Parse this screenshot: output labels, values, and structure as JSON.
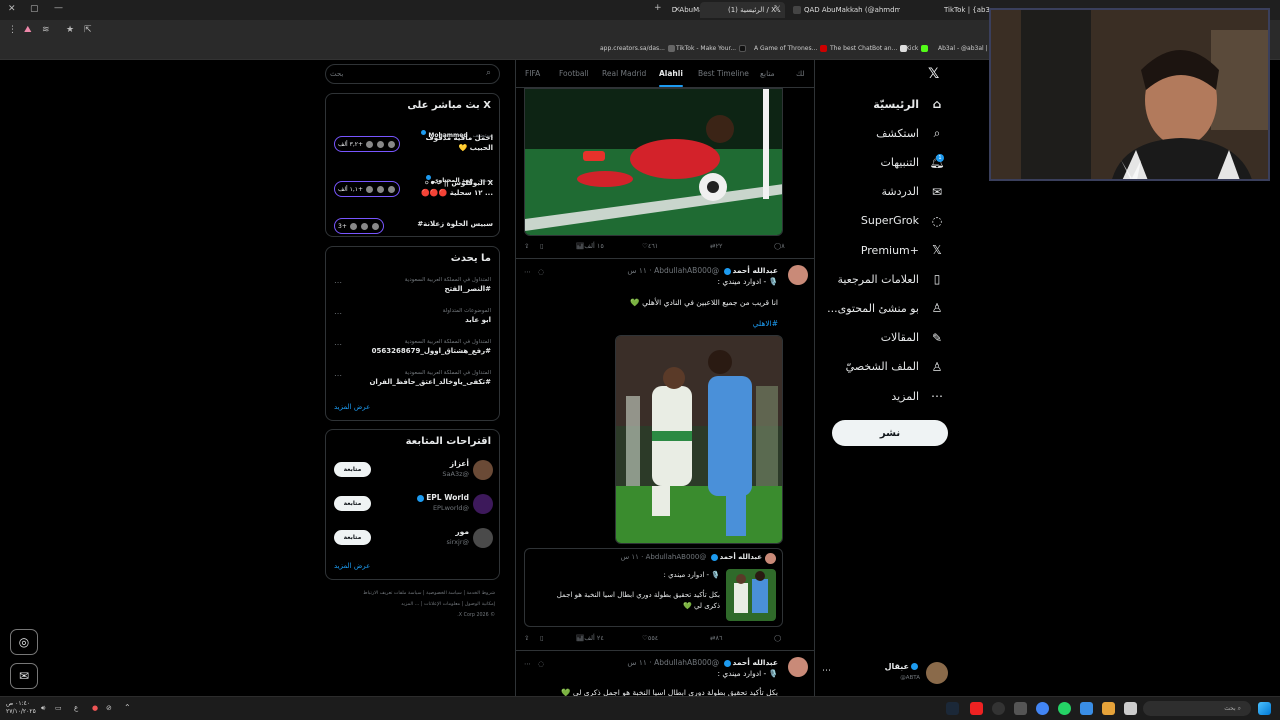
{
  "browser": {
    "tabs": [
      {
        "label": "(1) الرئيسية / X",
        "active": true
      },
      {
        "label": "QAD AbuMakkah (@ahmdmu...",
        "active": false
      },
      {
        "label": "TikTok | {ab3al...",
        "active": false
      }
    ],
    "bookmarks": [
      "app.creators.sa/das...",
      "TikTok - Make Your...",
      "A Game of Thrones...",
      "The best ChatBot an...",
      "Kick",
      "Ab3al - @ab3al |"
    ]
  },
  "nav": {
    "items": [
      {
        "label": "الرئيسيّة",
        "icon": "home-icon",
        "glyph": "⌂",
        "bold": true
      },
      {
        "label": "استكشف",
        "icon": "search-icon",
        "glyph": "⌕"
      },
      {
        "label": "التنبيهات",
        "icon": "bell-icon",
        "glyph": "🔔︎"
      },
      {
        "label": "الدردشة",
        "icon": "mail-icon",
        "glyph": "✉"
      },
      {
        "label": "SuperGrok",
        "icon": "grok-icon",
        "glyph": "◌"
      },
      {
        "label": "Premium+",
        "icon": "x-logo-icon",
        "glyph": "𝕏"
      },
      {
        "label": "العلامات المرجعية",
        "icon": "bookmark-icon",
        "glyph": "▯"
      },
      {
        "label": "...بو منشئ المحتوى",
        "icon": "creator-icon",
        "glyph": "♙"
      },
      {
        "label": "المقالات",
        "icon": "articles-icon",
        "glyph": "✎"
      },
      {
        "label": "الملف الشخصيّ",
        "icon": "profile-icon",
        "glyph": "♙"
      },
      {
        "label": "المزيد",
        "icon": "more-icon",
        "glyph": "⋯"
      }
    ],
    "notification_count": "1",
    "post_button": "نشر",
    "account": {
      "name": "عبقال",
      "handle": "@ABTA"
    }
  },
  "timeline": {
    "tabs": [
      "لك",
      "متابع",
      "Best Timeline",
      "Alahli",
      "Real Madrid",
      "Football",
      "FIFA"
    ],
    "selected_tab": "Alahli",
    "first_tweet_actions": {
      "replies": "٨",
      "retweets": "٢٢",
      "likes": "٤٦١",
      "views": "١٥ ألف"
    },
    "tweet2": {
      "name": "عبدالله أحمد",
      "handle": "@AbdullahAB000",
      "time": "١١ س",
      "line1": "🎙️ - ادوارد ميندي :",
      "line2": "انا قريب من جميع اللاعبين في النادي الأهلي 💚",
      "hashtag": "#الاهلي",
      "quote": {
        "name": "عبدالله أحمد",
        "handle": "@AbdullahAB000",
        "time": "١١ س",
        "line1": "🎙️ - ادوارد ميندي :",
        "line2": "بكل تأكيد تحقيق بطولة دوري ابطال اسيا النخبة هو اجمل",
        "line3": "ذكرى لي 💚"
      },
      "actions": {
        "replies": "",
        "retweets": "٨٦",
        "likes": "٥٥٤",
        "views": "٢٤ ألف"
      }
    },
    "tweet3": {
      "name": "عبدالله أحمد",
      "handle": "@AbdullahAB000",
      "time": "١١ س",
      "line1": "🎙️ - ادوارد ميندي :",
      "line2": "بكل تأكيد تحقيق بطولة دوري ابطال اسيا النخبة هو اجمل ذكرى لي 💚"
    }
  },
  "search": {
    "placeholder": "بحث"
  },
  "live": {
    "title": "X بث مباشر على",
    "items": [
      {
        "host": "Mohammed",
        "status": "يستضيف",
        "title": "احمل مافيه مدفوف",
        "title2": "الحبيب 💛",
        "count": "٣,٢ ألف+"
      },
      {
        "host": "فهد المحياوي",
        "status": "يتحدث",
        "title": "X البوقنوس || ⚪⚫⚪",
        "title2": "... ١٢ سحلية 🔴🔴🔴",
        "count": "١,١ ألف+"
      },
      {
        "host": "",
        "status": "",
        "title": "سبيس الحلوة زعلانة#",
        "title2": "",
        "count": "3+"
      }
    ]
  },
  "trends": {
    "title": "ما يحدث",
    "items": [
      {
        "context": "المتداول في المملكة العربية السعودية",
        "topic": "#النصر_الفتح"
      },
      {
        "context": "الموضوعات المتداولة",
        "topic": "ابو عابد"
      },
      {
        "context": "المتداول في المملكة العربية السعودية",
        "topic": "#رفع_هشتاق_اوول_0563268679"
      },
      {
        "context": "المتداول في المملكة العربية السعودية",
        "topic": "#تكفى_ياوخالد_اعتق_حافظ_الفران"
      }
    ],
    "show_more": "عرض المزيد"
  },
  "follow": {
    "title": "اقتراحات المتابعة",
    "items": [
      {
        "name": "أعزاز",
        "handle": "@SaA3z",
        "button": "متابعة",
        "verified": false
      },
      {
        "name": "EPL World",
        "handle": "@EPLworld",
        "button": "متابعة",
        "verified": true
      },
      {
        "name": "مور",
        "handle": "@sirxjr",
        "button": "متابعة",
        "verified": false
      }
    ],
    "show_more": "عرض المزيد"
  },
  "footer": {
    "links": [
      "شروط الخدمة",
      "سياسة الخصوصية",
      "سياسة ملفات تعريف الارتباط",
      "إمكانية الوصول",
      "معلومات الإعلانات",
      "... المزيد"
    ],
    "copyright": "© 2026 X Corp."
  },
  "taskbar": {
    "search_placeholder": "بحث",
    "time": "٠١:٤٠ ص",
    "date": "٢٧/١٠/٢٠٢٥",
    "lang": "ع"
  },
  "colors": {
    "accent": "#1d9bf0",
    "border": "#2f3336",
    "muted": "#71767b",
    "live": "#7856ff"
  }
}
